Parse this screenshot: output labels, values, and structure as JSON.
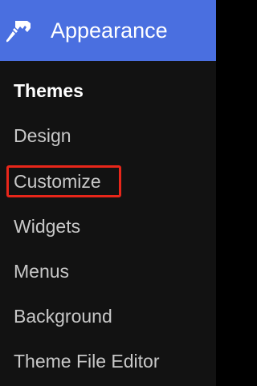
{
  "header": {
    "label": "Appearance",
    "icon": "paintbrush-icon",
    "background_color": "#4a6fe0"
  },
  "submenu": {
    "items": [
      {
        "label": "Themes",
        "active": true
      },
      {
        "label": "Design",
        "active": false
      },
      {
        "label": "Customize",
        "active": false,
        "highlighted": true
      },
      {
        "label": "Widgets",
        "active": false
      },
      {
        "label": "Menus",
        "active": false
      },
      {
        "label": "Background",
        "active": false
      },
      {
        "label": "Theme File Editor",
        "active": false
      }
    ]
  },
  "colors": {
    "highlight_border": "#e8261a",
    "submenu_background": "#121212",
    "item_text": "#c8c8c8",
    "active_item_text": "#ffffff"
  }
}
